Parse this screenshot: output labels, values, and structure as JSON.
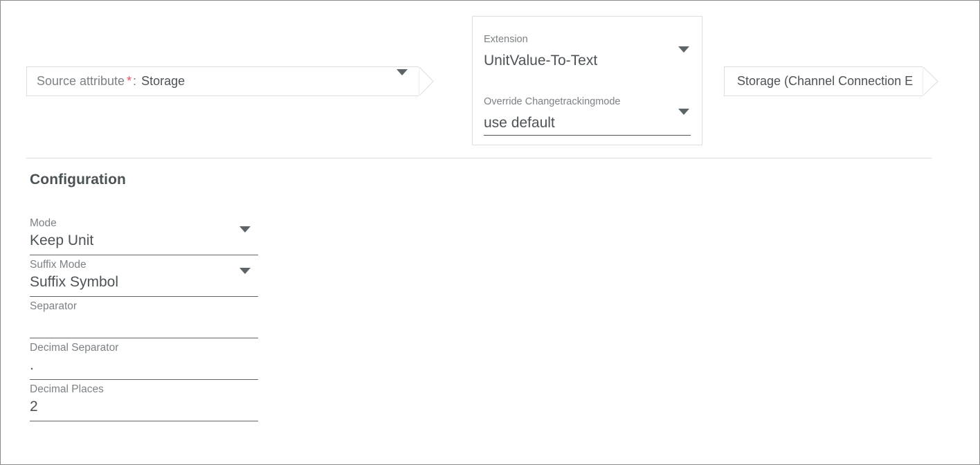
{
  "source_attribute": {
    "label": "Source attribute",
    "required_marker": "*",
    "colon": ":",
    "value": "Storage",
    "caret_icon": "chevron-down-icon"
  },
  "extension_panel": {
    "fields": [
      {
        "label": "Extension",
        "value": "UnitValue-To-Text",
        "caret_icon": "chevron-down-icon",
        "underline": false
      },
      {
        "label": "Override Changetrackingmode",
        "value": "use default",
        "caret_icon": "chevron-down-icon",
        "underline": true
      }
    ]
  },
  "target_attribute": {
    "value": "Storage (Channel Connection E",
    "value_full": "Storage (Channel Connection E…"
  },
  "configuration": {
    "title": "Configuration",
    "fields": [
      {
        "label": "Mode",
        "value": "Keep Unit",
        "type": "select",
        "caret_icon": "chevron-down-icon"
      },
      {
        "label": "Suffix Mode",
        "value": "Suffix Symbol",
        "type": "select",
        "caret_icon": "chevron-down-icon"
      },
      {
        "label": "Separator",
        "value": "",
        "type": "text"
      },
      {
        "label": "Decimal Separator",
        "value": ".",
        "type": "text"
      },
      {
        "label": "Decimal Places",
        "value": "2",
        "type": "text"
      }
    ]
  },
  "colors": {
    "label_gray": "#7b8285",
    "value_dark": "#4c5356",
    "required_red": "#e8505b",
    "border_light": "#dddddd",
    "underline_dark": "#5f676a",
    "page_border": "#8a8a8a"
  }
}
